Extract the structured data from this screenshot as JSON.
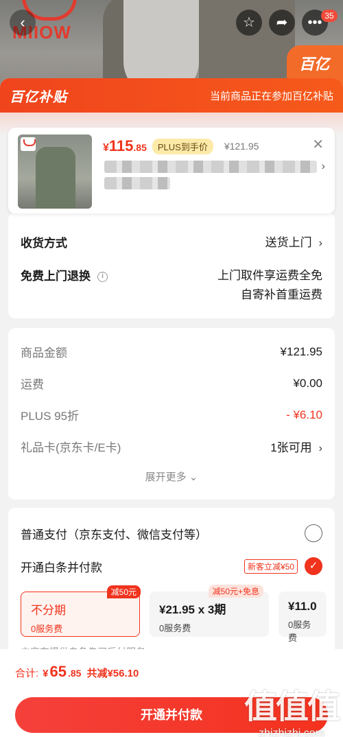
{
  "hero": {
    "brand": "MIIOW",
    "badge_count": "35",
    "side_tag": "百亿"
  },
  "banner": {
    "logo": "百亿补贴",
    "note": "当前商品正在参加百亿补贴"
  },
  "product": {
    "price_yen": "¥",
    "price_int": "115",
    "price_dec": ".85",
    "plus_label": "PLUS到手价",
    "original_price": "¥121.95"
  },
  "delivery": {
    "shipping_label": "收货方式",
    "shipping_value": "送货上门",
    "return_label": "免费上门退换",
    "return_line1": "上门取件享运费全免",
    "return_line2": "自寄补首重运费"
  },
  "amounts": {
    "rows": [
      {
        "label": "商品金额",
        "value": "¥121.95"
      },
      {
        "label": "运费",
        "value": "¥0.00"
      },
      {
        "label": "PLUS 95折",
        "value": "- ¥6.10"
      },
      {
        "label": "礼品卡(京东卡/E卡)",
        "value": "1张可用"
      }
    ],
    "more": "展开更多"
  },
  "payment": {
    "normal_label": "普通支付（京东支付、微信支付等）",
    "baitiao_label": "开通白条并付款",
    "new_customer": "新客立减¥50",
    "plans": [
      {
        "tag": "减50元",
        "title": "不分期",
        "sub": "0服务费"
      },
      {
        "tag": "减50元+免息",
        "title": "¥21.95 x 3期",
        "sub": "0服务费"
      },
      {
        "tag": "",
        "title": "¥11.0",
        "sub": "0服务费"
      }
    ],
    "note": "由京东提供白条先买后付服务"
  },
  "bottom": {
    "total_label": "合计:",
    "total_yen": "¥",
    "total_int": "65",
    "total_dec": ".85",
    "saved": "共减¥56.10",
    "pay_button": "开通并付款"
  },
  "watermark": {
    "big": "值值值",
    "url": "zhizhizhi.com"
  },
  "colors": {
    "accent_red": "#f0331d",
    "banner_orange": "#f65a1b",
    "plus_gold": "#fbeaa8"
  }
}
